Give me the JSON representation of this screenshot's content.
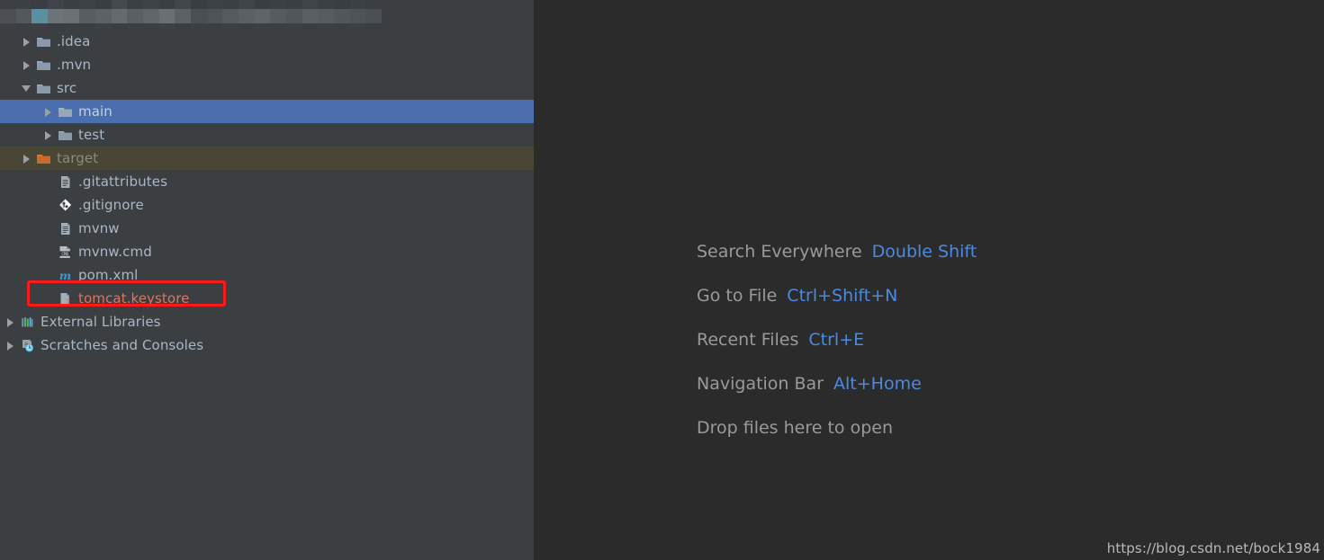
{
  "colors": {
    "sidebar_bg": "#3c3f41",
    "editor_bg": "#2b2b2b",
    "selection_blue": "#4b6eaf",
    "excluded_olive": "#4a4636",
    "tree_text": "#a9b7c6",
    "keystore_text": "#e2725b",
    "annotation_red": "#ff1a1a",
    "hint_text": "#9a9a9a",
    "hint_key_blue": "#4b8ae0",
    "folder_gray": "#8a9aa8",
    "folder_orange": "#cc6a2a"
  },
  "sidebar": {
    "project_root_row": {
      "label": "",
      "obscured": true,
      "note": "pixelated mosaic overlay"
    },
    "tree": [
      {
        "label": ".idea",
        "icon": "folder-icon",
        "indent": 1,
        "arrow": "closed",
        "state": "obscured"
      },
      {
        "label": ".mvn",
        "icon": "folder-icon",
        "indent": 1,
        "arrow": "closed",
        "state": "normal"
      },
      {
        "label": "src",
        "icon": "folder-icon",
        "indent": 1,
        "arrow": "open",
        "state": "normal"
      },
      {
        "label": "main",
        "icon": "folder-icon",
        "indent": 2,
        "arrow": "closed",
        "state": "selected"
      },
      {
        "label": "test",
        "icon": "folder-icon",
        "indent": 2,
        "arrow": "closed",
        "state": "normal"
      },
      {
        "label": "target",
        "icon": "folder-orange-icon",
        "indent": 1,
        "arrow": "closed",
        "state": "excluded"
      },
      {
        "label": ".gitattributes",
        "icon": "text-file-icon",
        "indent": 2,
        "arrow": "none",
        "state": "normal"
      },
      {
        "label": ".gitignore",
        "icon": "git-icon",
        "indent": 2,
        "arrow": "none",
        "state": "normal"
      },
      {
        "label": "mvnw",
        "icon": "text-file-icon",
        "indent": 2,
        "arrow": "none",
        "state": "normal"
      },
      {
        "label": "mvnw.cmd",
        "icon": "cmd-file-icon",
        "indent": 2,
        "arrow": "none",
        "state": "normal"
      },
      {
        "label": "pom.xml",
        "icon": "maven-file-icon",
        "indent": 2,
        "arrow": "none",
        "state": "normal"
      },
      {
        "label": "tomcat.keystore",
        "icon": "unknown-file-icon",
        "indent": 2,
        "arrow": "none",
        "state": "keystore"
      },
      {
        "label": "External Libraries",
        "icon": "libraries-icon",
        "indent": 0,
        "arrow": "closed",
        "state": "normal"
      },
      {
        "label": "Scratches and Consoles",
        "icon": "scratches-icon",
        "indent": 0,
        "arrow": "closed",
        "state": "normal"
      }
    ],
    "annotation": {
      "type": "red-rectangle",
      "targets": "tomcat.keystore"
    }
  },
  "editor": {
    "hints": [
      {
        "action": "Search Everywhere",
        "shortcut": "Double Shift"
      },
      {
        "action": "Go to File",
        "shortcut": "Ctrl+Shift+N"
      },
      {
        "action": "Recent Files",
        "shortcut": "Ctrl+E"
      },
      {
        "action": "Navigation Bar",
        "shortcut": "Alt+Home"
      },
      {
        "action": "Drop files here to open",
        "shortcut": ""
      }
    ],
    "watermark": "https://blog.csdn.net/bock1984"
  }
}
